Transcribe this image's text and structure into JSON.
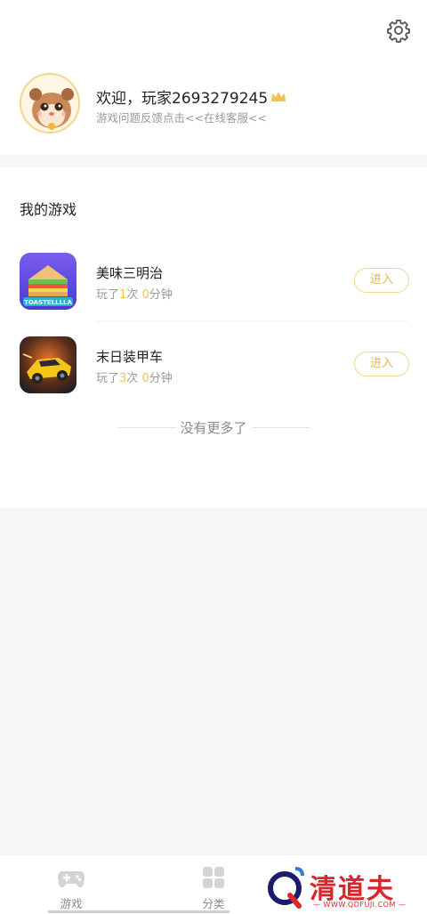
{
  "profile": {
    "welcome": "欢迎，玩家2693279245",
    "feedback": "游戏问题反馈点击<<在线客服<<"
  },
  "games_section": {
    "title": "我的游戏",
    "items": [
      {
        "name": "美味三明治",
        "stats_prefix": "玩了",
        "times": "1",
        "times_unit": "次",
        "minutes": "0",
        "minutes_unit": "分钟",
        "enter_label": "进入",
        "icon_text": "TOASTELLLLA"
      },
      {
        "name": "末日装甲车",
        "stats_prefix": "玩了",
        "times": "3",
        "times_unit": "次",
        "minutes": "0",
        "minutes_unit": "分钟",
        "enter_label": "进入"
      }
    ],
    "end_text": "没有更多了"
  },
  "tabbar": {
    "tabs": [
      {
        "label": "游戏",
        "icon": "gamepad-icon"
      },
      {
        "label": "分类",
        "icon": "grid-icon"
      }
    ]
  },
  "watermark": {
    "text": "清道夫",
    "sub": "— WWW.QDFUJI.COM —"
  },
  "colors": {
    "accent": "#f2c24e",
    "watermark": "#d9262c"
  }
}
